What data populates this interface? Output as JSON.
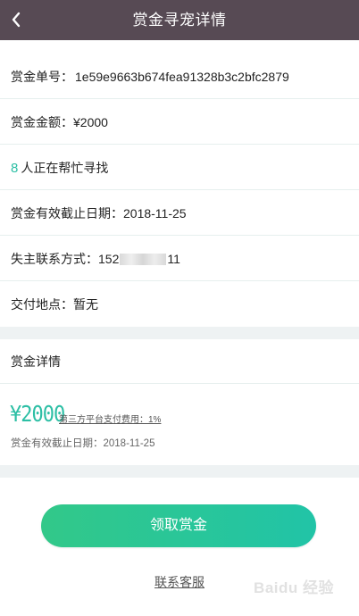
{
  "header": {
    "title": "赏金寻宠详情",
    "back_icon": "chevron-left-icon"
  },
  "rows": {
    "order_label": "赏金单号：",
    "order_value": "1e59e9663b674fea91328b3c2bfc2879",
    "amount_label": "赏金金额：",
    "amount_value": "¥2000",
    "helpers_count": "8",
    "helpers_text": "人正在帮忙寻找",
    "deadline_label": "赏金有效截止日期：",
    "deadline_value": "2018-11-25",
    "contact_label": "失主联系方式：",
    "contact_prefix": "152",
    "contact_suffix": "11",
    "location_label": "交付地点：",
    "location_value": "暂无"
  },
  "detail": {
    "title": "赏金详情",
    "amount": "¥2000",
    "fee_text": "第三方平台支付费用：1%",
    "deadline_text": "赏金有效截止日期：2018-11-25"
  },
  "actions": {
    "claim_label": "领取赏金",
    "service_label": "联系客服"
  },
  "watermark": "Baidu 经验",
  "colors": {
    "header_bg": "#574a54",
    "accent": "#2dbfa5",
    "button_gradient_start": "#32c889",
    "button_gradient_end": "#21c4a7"
  }
}
